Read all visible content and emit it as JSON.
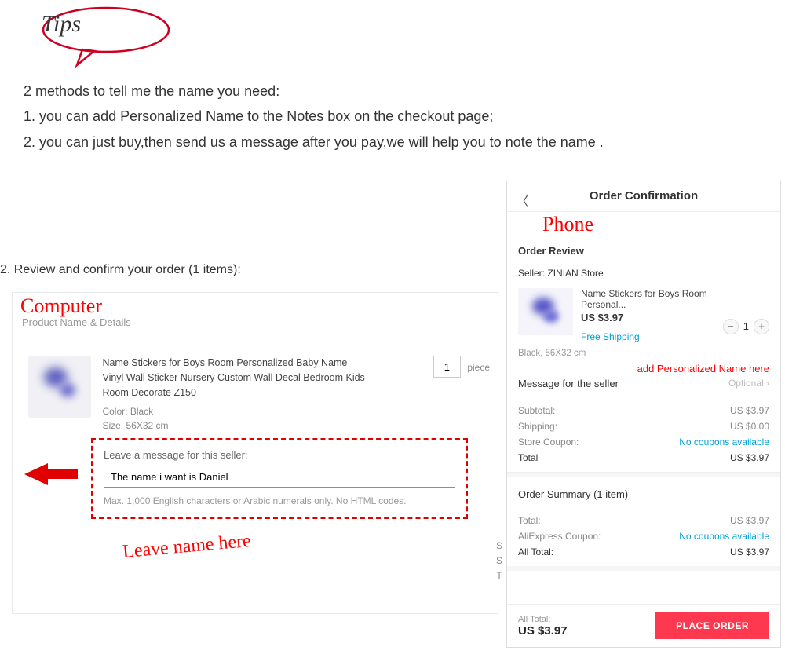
{
  "tips_label": "Tips",
  "instructions": {
    "line0": "2 methods to tell me the name you need:",
    "line1": "1. you can add Personalized Name to the Notes box on the checkout page;",
    "line2": "2. you can just buy,then send us a message after you pay,we will help you to note the name ."
  },
  "review_header": "2. Review and confirm your order (1 items):",
  "computer": {
    "label": "Computer",
    "subtitle": "Product Name & Details",
    "product_name": "Name Stickers for Boys Room Personalized Baby Name Vinyl Wall Sticker Nursery Custom Wall Decal Bedroom Kids Room Decorate Z150",
    "color_label": "Color:",
    "color_value": "Black",
    "size_label": "Size:",
    "size_value": "56X32 cm",
    "qty_value": "1",
    "qty_unit": "piece",
    "msg_label": "Leave a message for this seller:",
    "msg_value": "The name i want is Daniel",
    "msg_hint": "Max. 1,000 English characters or Arabic numerals only. No HTML codes.",
    "leave_name": "Leave name here"
  },
  "phone": {
    "label": "Phone",
    "title": "Order Confirmation",
    "review_label": "Order Review",
    "seller_label": "Seller:",
    "seller_name": "ZINIAN Store",
    "product_name": "Name Stickers for Boys Room Personal...",
    "price": "US $3.97",
    "shipping_text": "Free Shipping",
    "qty": "1",
    "attrs": "Black, 56X32 cm",
    "add_name_note": "add Personalized Name here",
    "msg_seller": "Message for the seller",
    "optional": "Optional",
    "summary": {
      "subtotal_label": "Subtotal:",
      "subtotal_val": "US $3.97",
      "shipping_label": "Shipping:",
      "shipping_val": "US $0.00",
      "coupon_label": "Store Coupon:",
      "coupon_val": "No coupons available",
      "total_label": "Total",
      "total_val": "US $3.97"
    },
    "order_summary_title": "Order Summary (1 item)",
    "os": {
      "total_label": "Total:",
      "total_val": "US $3.97",
      "ali_label": "AliExpress Coupon:",
      "ali_val": "No coupons available",
      "all_label": "All Total:",
      "all_val": "US $3.97"
    },
    "footer": {
      "all_label": "All Total:",
      "all_val": "US $3.97",
      "btn": "PLACE ORDER"
    },
    "side_letters": "S\nS\nT"
  }
}
